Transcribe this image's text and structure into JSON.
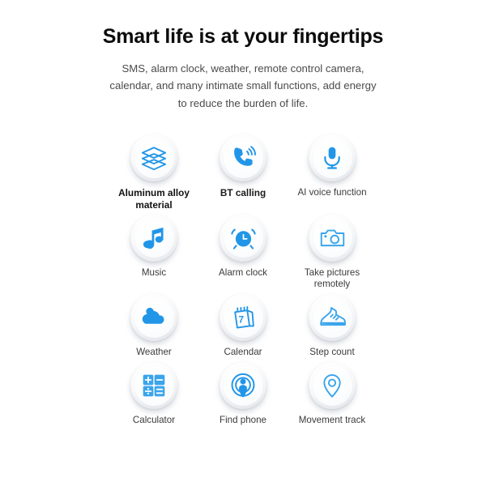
{
  "header": {
    "title": "Smart life is at your fingertips",
    "description": "SMS, alarm clock, weather, remote control camera, calendar, and many intimate small functions, add energy to reduce the burden of life."
  },
  "theme": {
    "accent_blue": "#2196E8",
    "accent_blue_light": "#43A9ED",
    "background": "#FFFFFF",
    "text_dark": "#0C0C0C",
    "text_body": "#4B4B4B"
  },
  "features": [
    {
      "icon": "layers-icon",
      "label": "Aluminum alloy material",
      "emphasis": "strong"
    },
    {
      "icon": "bt-calling-icon",
      "label": "BT calling",
      "emphasis": "strong"
    },
    {
      "icon": "microphone-icon",
      "label": "AI voice function",
      "emphasis": "normal"
    },
    {
      "icon": "music-note-icon",
      "label": "Music",
      "emphasis": "normal"
    },
    {
      "icon": "alarm-clock-icon",
      "label": "Alarm clock",
      "emphasis": "normal"
    },
    {
      "icon": "camera-icon",
      "label": "Take pictures remotely",
      "emphasis": "normal"
    },
    {
      "icon": "cloud-sun-icon",
      "label": "Weather",
      "emphasis": "normal"
    },
    {
      "icon": "calendar-icon",
      "label": "Calendar",
      "emphasis": "normal"
    },
    {
      "icon": "sneaker-icon",
      "label": "Step count",
      "emphasis": "normal"
    },
    {
      "icon": "calculator-icon",
      "label": "Calculator",
      "emphasis": "normal"
    },
    {
      "icon": "find-phone-icon",
      "label": "Find phone",
      "emphasis": "normal"
    },
    {
      "icon": "location-pin-icon",
      "label": "Movement track",
      "emphasis": "normal"
    }
  ],
  "calendar_icon": {
    "day_number": "7"
  },
  "calculator_icon": {
    "keys": [
      "+",
      "−",
      "÷",
      "="
    ]
  }
}
